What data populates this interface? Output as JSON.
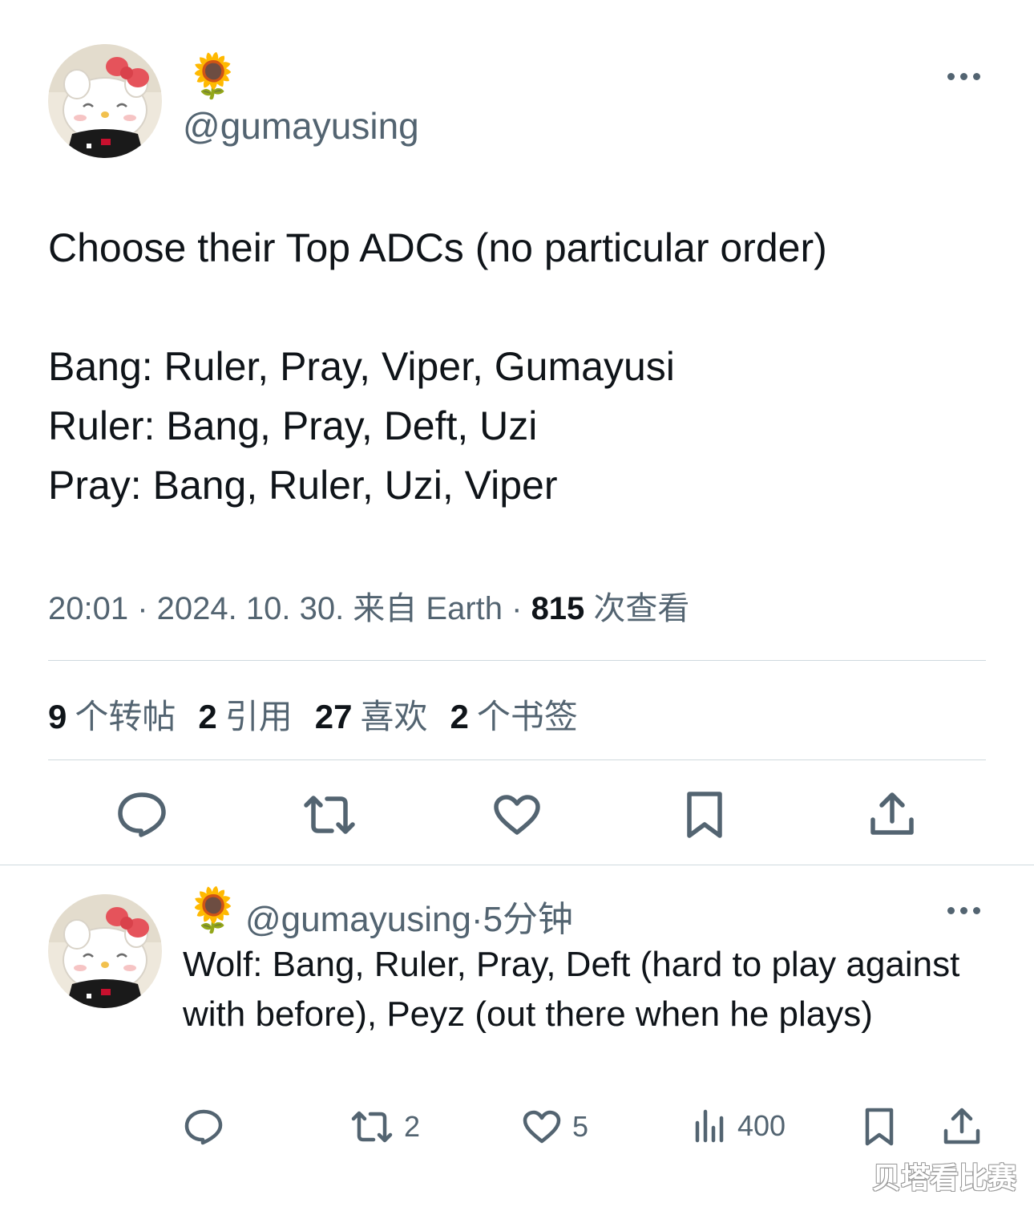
{
  "tweet": {
    "author_emoji": "🌻",
    "handle": "@gumayusing",
    "text": "Choose their Top ADCs (no particular order)\n\nBang: Ruler, Pray, Viper, Gumayusi\nRuler: Bang, Pray, Deft, Uzi\nPray: Bang, Ruler, Uzi, Viper",
    "time": "20:01 · 2024. 10. 30. 来自 Earth · ",
    "views_count": "815",
    "views_label": " 次查看",
    "stats": [
      {
        "count": "9",
        "label": "个转帖"
      },
      {
        "count": "2",
        "label": "引用"
      },
      {
        "count": "27",
        "label": "喜欢"
      },
      {
        "count": "2",
        "label": "个书签"
      }
    ],
    "actions": [
      "reply-icon",
      "retweet-icon",
      "like-icon",
      "bookmark-icon",
      "share-icon"
    ]
  },
  "reply": {
    "author_emoji": "🌻",
    "handle": "@gumayusing",
    "time": "·5分钟",
    "text": "Wolf: Bang, Ruler, Pray, Deft (hard to play against with before), Peyz (out there when he plays)",
    "retweets": "2",
    "likes": "5",
    "views": "400"
  },
  "watermark": "贝塔看比赛",
  "colors": {
    "text": "#0f1419",
    "muted": "#536471",
    "divider": "#cfd9de"
  }
}
